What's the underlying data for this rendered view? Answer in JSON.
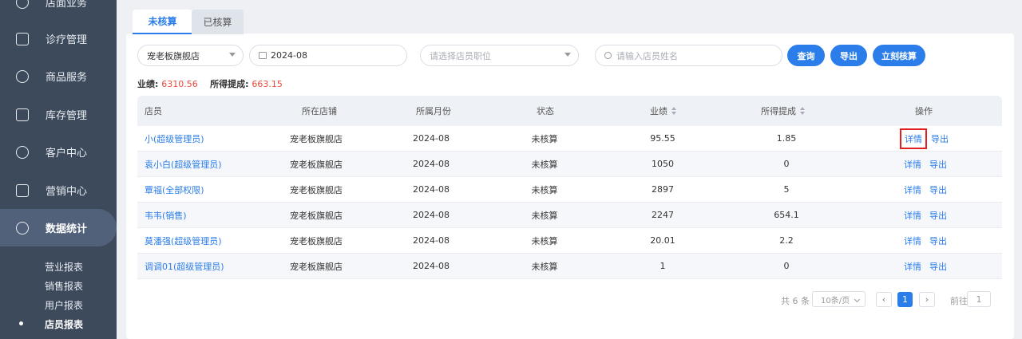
{
  "sidebar": {
    "items": [
      {
        "label": "店面业务",
        "icon": "store-icon"
      },
      {
        "label": "诊疗管理",
        "icon": "medical-kit-icon"
      },
      {
        "label": "商品服务",
        "icon": "bag-icon"
      },
      {
        "label": "库存管理",
        "icon": "box-icon"
      },
      {
        "label": "客户中心",
        "icon": "user-icon"
      },
      {
        "label": "营销中心",
        "icon": "bar-chart-icon"
      },
      {
        "label": "数据统计",
        "icon": "trend-icon"
      }
    ],
    "subitems": [
      "营业报表",
      "销售报表",
      "用户报表",
      "店员报表"
    ]
  },
  "tabs": {
    "active": "未核算",
    "inactive": "已核算"
  },
  "filters": {
    "store": "宠老板旗舰店",
    "month": "2024-08",
    "position_placeholder": "请选择店员职位",
    "name_placeholder": "请输入店员姓名"
  },
  "buttons": {
    "query": "查询",
    "export": "导出",
    "settle": "立刻核算"
  },
  "summary": {
    "perf_label": "业绩:",
    "perf_value": "6310.56",
    "comm_label": "所得提成:",
    "comm_value": "663.15"
  },
  "table": {
    "headers": [
      "店员",
      "所在店铺",
      "所属月份",
      "状态",
      "业绩",
      "所得提成",
      "操作"
    ],
    "rows": [
      {
        "name": "小(超级管理员)",
        "store": "宠老板旗舰店",
        "month": "2024-08",
        "status": "未核算",
        "perf": "95.55",
        "comm": "1.85",
        "op1": "详情",
        "op2": "导出"
      },
      {
        "name": "袁小白(超级管理员)",
        "store": "宠老板旗舰店",
        "month": "2024-08",
        "status": "未核算",
        "perf": "1050",
        "comm": "0",
        "op1": "详情",
        "op2": "导出"
      },
      {
        "name": "覃福(全部权限)",
        "store": "宠老板旗舰店",
        "month": "2024-08",
        "status": "未核算",
        "perf": "2897",
        "comm": "5",
        "op1": "详情",
        "op2": "导出"
      },
      {
        "name": "韦韦(销售)",
        "store": "宠老板旗舰店",
        "month": "2024-08",
        "status": "未核算",
        "perf": "2247",
        "comm": "654.1",
        "op1": "详情",
        "op2": "导出"
      },
      {
        "name": "莫潘强(超级管理员)",
        "store": "宠老板旗舰店",
        "month": "2024-08",
        "status": "未核算",
        "perf": "20.01",
        "comm": "2.2",
        "op1": "详情",
        "op2": "导出"
      },
      {
        "name": "调调01(超级管理员)",
        "store": "宠老板旗舰店",
        "month": "2024-08",
        "status": "未核算",
        "perf": "1",
        "comm": "0",
        "op1": "详情",
        "op2": "导出"
      }
    ]
  },
  "pagination": {
    "total": "共 6 条",
    "page_size": "10条/页",
    "prev": "‹",
    "current": "1",
    "next": "›",
    "goto_label": "前往",
    "goto_value": "1"
  }
}
